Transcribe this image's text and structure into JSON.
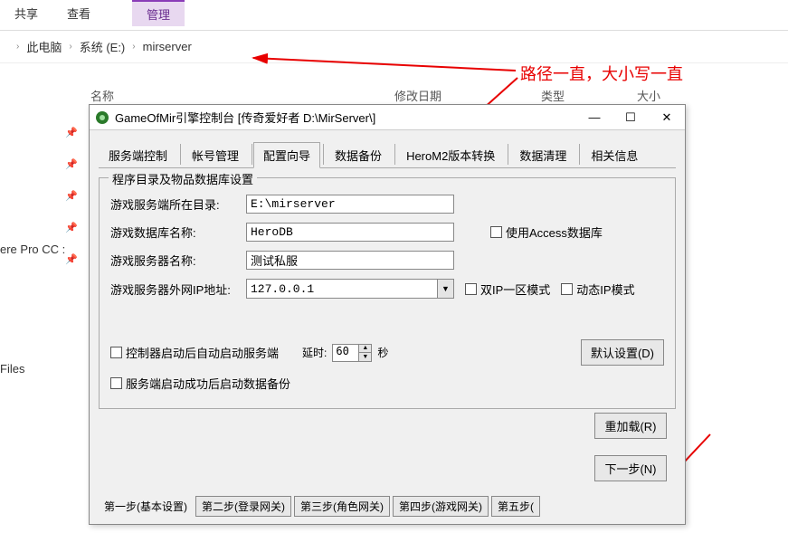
{
  "explorer": {
    "tabs": {
      "share": "共享",
      "view": "查看",
      "manage": "管理"
    },
    "breadcrumb": {
      "thispc": "此电脑",
      "drive": "系统 (E:)",
      "folder": "mirserver"
    },
    "columns": {
      "name": "名称",
      "date": "修改日期",
      "type": "类型",
      "size": "大小"
    },
    "sidebar": {
      "item1": "ere Pro CC :",
      "item2": "Files"
    }
  },
  "annotation": {
    "text": "路径一直，大小写一直"
  },
  "dialog": {
    "title": "GameOfMir引擎控制台 [传奇爱好者 D:\\MirServer\\]",
    "tabs": [
      "服务端控制",
      "帐号管理",
      "配置向导",
      "数据备份",
      "HeroM2版本转换",
      "数据清理",
      "相关信息"
    ],
    "active_tab": 2,
    "group": {
      "title": "程序目录及物品数据库设置",
      "labels": {
        "dir": "游戏服务端所在目录:",
        "db": "游戏数据库名称:",
        "server": "游戏服务器名称:",
        "ip": "游戏服务器外网IP地址:"
      },
      "values": {
        "dir": "E:\\mirserver",
        "db": "HeroDB",
        "server": "测试私服",
        "ip": "127.0.0.1"
      },
      "checkboxes": {
        "access": "使用Access数据库",
        "dualip": "双IP一区模式",
        "dynamicip": "动态IP模式",
        "autostart": "控制器启动后自动启动服务端",
        "autobackup": "服务端启动成功后启动数据备份"
      },
      "delay": {
        "label": "延时:",
        "value": "60",
        "unit": "秒"
      },
      "default_btn": "默认设置(D)"
    },
    "buttons": {
      "reload": "重加载(R)",
      "next": "下一步(N)"
    },
    "steps": [
      "第一步(基本设置)",
      "第二步(登录网关)",
      "第三步(角色网关)",
      "第四步(游戏网关)",
      "第五步("
    ]
  }
}
